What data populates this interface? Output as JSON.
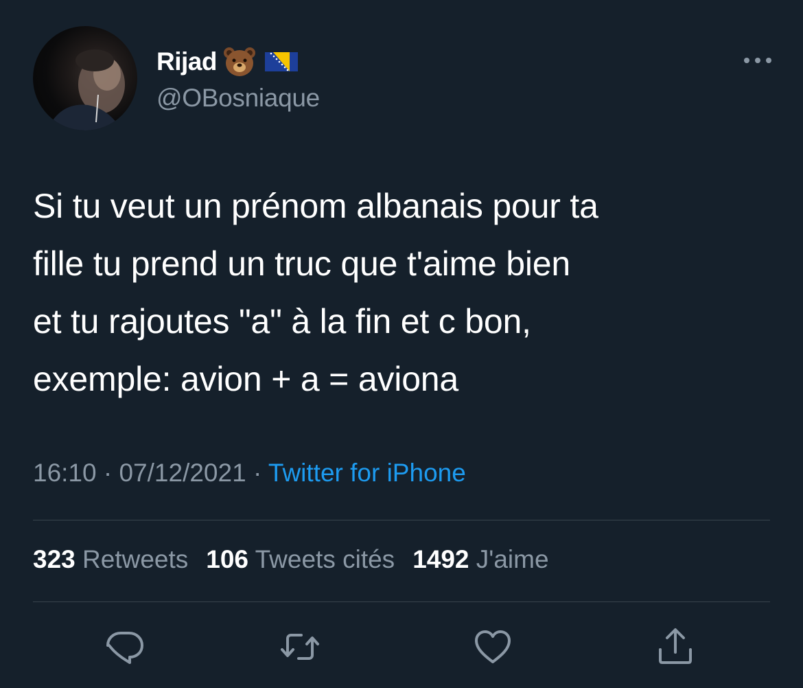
{
  "user": {
    "display_name": "Rijad",
    "name_emoji": "bear-face-emoji",
    "name_flag": "bosnia-herzegovina-flag",
    "handle": "@OBosniaque",
    "avatar": "profile-photo"
  },
  "tweet": {
    "text": "Si tu veut un prénom albanais pour ta\nfille tu prend un truc que t'aime bien\net tu rajoutes \"a\" à la fin et c bon,\nexemple: avion + a = aviona"
  },
  "meta": {
    "time": "16:10",
    "dot1": " · ",
    "date": "07/12/2021",
    "dot2": " · ",
    "source": "Twitter for iPhone"
  },
  "stats": {
    "retweets": {
      "count": "323",
      "label": "Retweets"
    },
    "quotes": {
      "count": "106",
      "label": "Tweets cités"
    },
    "likes": {
      "count": "1492",
      "label": "J'aime"
    }
  },
  "icons": {
    "more": "more-dots-icon",
    "reply": "reply-icon",
    "retweet": "retweet-icon",
    "like": "heart-icon",
    "share": "share-icon"
  },
  "colors": {
    "background": "#15202b",
    "text": "#ffffff",
    "secondary": "#8b98a5",
    "link": "#1d9bf0",
    "divider": "#38444d"
  }
}
